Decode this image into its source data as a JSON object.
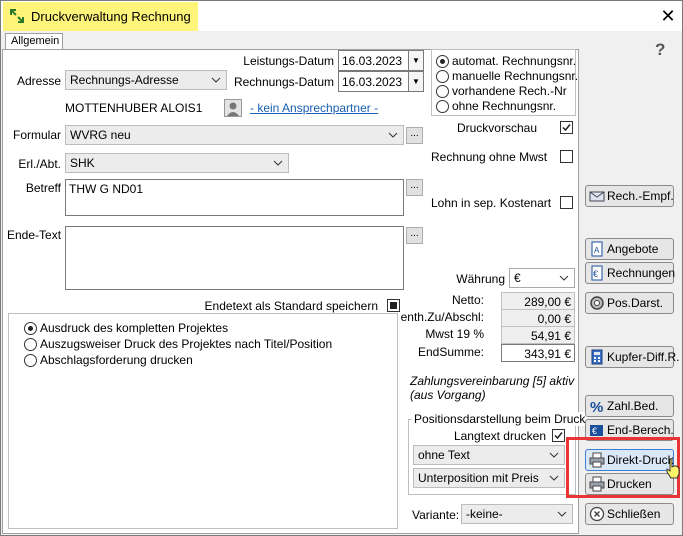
{
  "window": {
    "title": "Druckverwaltung Rechnung",
    "close_glyph": "✕",
    "help_glyph": "?"
  },
  "tabs": [
    {
      "label": "Allgemein"
    }
  ],
  "form": {
    "leistungs_label": "Leistungs-Datum",
    "leistungs_value": "16.03.2023",
    "rechnungs_label": "Rechnungs-Datum",
    "rechnungs_value": "16.03.2023",
    "adresse_label": "Adresse",
    "adresse_value": "Rechnungs-Adresse",
    "customer_name": "MOTTENHUBER ALOIS1",
    "contact_link": "- kein Ansprechpartner -",
    "formular_label": "Formular",
    "formular_value": "WVRG neu",
    "erl_label": "Erl./Abt.",
    "erl_value": "SHK",
    "betreff_label": "Betreff",
    "betreff_value": "THW G ND01",
    "endetext_label": "Ende-Text",
    "endetext_value": "",
    "endetext_save_label": "Endetext als Standard speichern",
    "dots_label": "...",
    "date_dropdown": "▼"
  },
  "numbering": {
    "options": [
      {
        "label": "automat. Rechnungsnr.",
        "selected": true
      },
      {
        "label": "manuelle Rechnungsnr.",
        "selected": false
      },
      {
        "label": "vorhandene Rech.-Nr",
        "selected": false
      },
      {
        "label": "ohne Rechnungsnr.",
        "selected": false
      }
    ]
  },
  "options": {
    "druckvorschau_label": "Druckvorschau",
    "druckvorschau_checked": true,
    "ohne_mwst_label": "Rechnung ohne Mwst",
    "ohne_mwst_checked": false,
    "lohn_label": "Lohn in sep. Kostenart",
    "lohn_checked": false
  },
  "totals": {
    "waehrung_label": "Währung",
    "waehrung_value": "€",
    "rows": [
      {
        "label": "Netto:",
        "value": "289,00 €"
      },
      {
        "label": "enth.Zu/Abschl:",
        "value": "0,00 €"
      },
      {
        "label": "Mwst 19 %",
        "value": "54,91 €"
      },
      {
        "label": "EndSumme:",
        "value": "343,91 €"
      }
    ]
  },
  "print_scope": {
    "options": [
      {
        "label": "Ausdruck des kompletten Projektes",
        "selected": true
      },
      {
        "label": "Auszugsweiser Druck des Projektes nach Titel/Position",
        "selected": false
      },
      {
        "label": "Abschlagsforderung drucken",
        "selected": false
      }
    ]
  },
  "payment_note": {
    "line1": "Zahlungsvereinbarung [5] aktiv",
    "line2": "(aus Vorgang)"
  },
  "position_display": {
    "group_label": "Positionsdarstellung beim Druck",
    "langtext_label": "Langtext drucken",
    "langtext_checked": true,
    "text_mode": "ohne Text",
    "subposition_mode": "Unterposition mit Preis"
  },
  "variant": {
    "label": "Variante:",
    "value": "-keine-"
  },
  "sidebar_buttons": {
    "rech_empf": "Rech.-Empf.",
    "angebote": "Angebote",
    "rechnungen": "Rechnungen",
    "pos_darst": "Pos.Darst.",
    "kupfer": "Kupfer-Diff.R.",
    "zahl_bed": "Zahl.Bed.",
    "end_berech": "End-Berech.",
    "direkt_druck": "Direkt-Druck",
    "drucken": "Drucken",
    "schliessen": "Schließen"
  },
  "colors": {
    "title_highlight": "#fff47a",
    "focus_box": "#e83434",
    "link": "#1a5fb4"
  }
}
